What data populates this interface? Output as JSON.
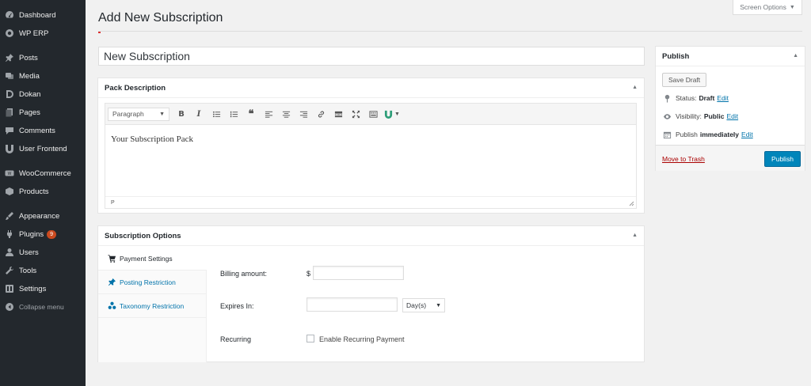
{
  "sidebar": {
    "items": [
      {
        "label": "Dashboard",
        "icon": "dashboard-icon"
      },
      {
        "label": "WP ERP",
        "icon": "erp-icon"
      },
      {
        "label": "Posts",
        "icon": "pin-icon"
      },
      {
        "label": "Media",
        "icon": "media-icon"
      },
      {
        "label": "Dokan",
        "icon": "dokan-icon"
      },
      {
        "label": "Pages",
        "icon": "pages-icon"
      },
      {
        "label": "Comments",
        "icon": "comments-icon"
      },
      {
        "label": "User Frontend",
        "icon": "user-frontend-icon"
      },
      {
        "label": "WooCommerce",
        "icon": "woocommerce-icon"
      },
      {
        "label": "Products",
        "icon": "products-icon"
      },
      {
        "label": "Appearance",
        "icon": "appearance-icon"
      },
      {
        "label": "Plugins",
        "icon": "plugins-icon",
        "badge": "9"
      },
      {
        "label": "Users",
        "icon": "users-icon"
      },
      {
        "label": "Tools",
        "icon": "tools-icon"
      },
      {
        "label": "Settings",
        "icon": "settings-icon"
      },
      {
        "label": "Collapse menu",
        "icon": "collapse-icon"
      }
    ]
  },
  "header": {
    "title": "Add New Subscription",
    "screen_options": "Screen Options"
  },
  "post": {
    "title_value": "New Subscription"
  },
  "pack_description": {
    "heading": "Pack Description",
    "format_select": "Paragraph",
    "content": "Your Subscription Pack",
    "path": "P"
  },
  "subscription_options": {
    "heading": "Subscription Options",
    "tabs": [
      {
        "label": "Payment Settings"
      },
      {
        "label": "Posting Restriction"
      },
      {
        "label": "Taxonomy Restriction"
      }
    ],
    "billing_label": "Billing amount:",
    "currency": "$",
    "expires_label": "Expires In:",
    "expires_unit": "Day(s)",
    "recurring_label": "Recurring",
    "recurring_checkbox": "Enable Recurring Payment"
  },
  "publish": {
    "heading": "Publish",
    "save_draft": "Save Draft",
    "status_label": "Status:",
    "status_value": "Draft",
    "visibility_label": "Visibility:",
    "visibility_value": "Public",
    "publish_label": "Publish",
    "publish_value": "immediately",
    "edit": "Edit",
    "trash": "Move to Trash",
    "publish_button": "Publish"
  },
  "colors": {
    "sidebar_bg": "#23282d",
    "accent": "#0073aa",
    "publish_button": "#0085ba",
    "trash": "#aa0000",
    "badge": "#ca4a1f"
  }
}
